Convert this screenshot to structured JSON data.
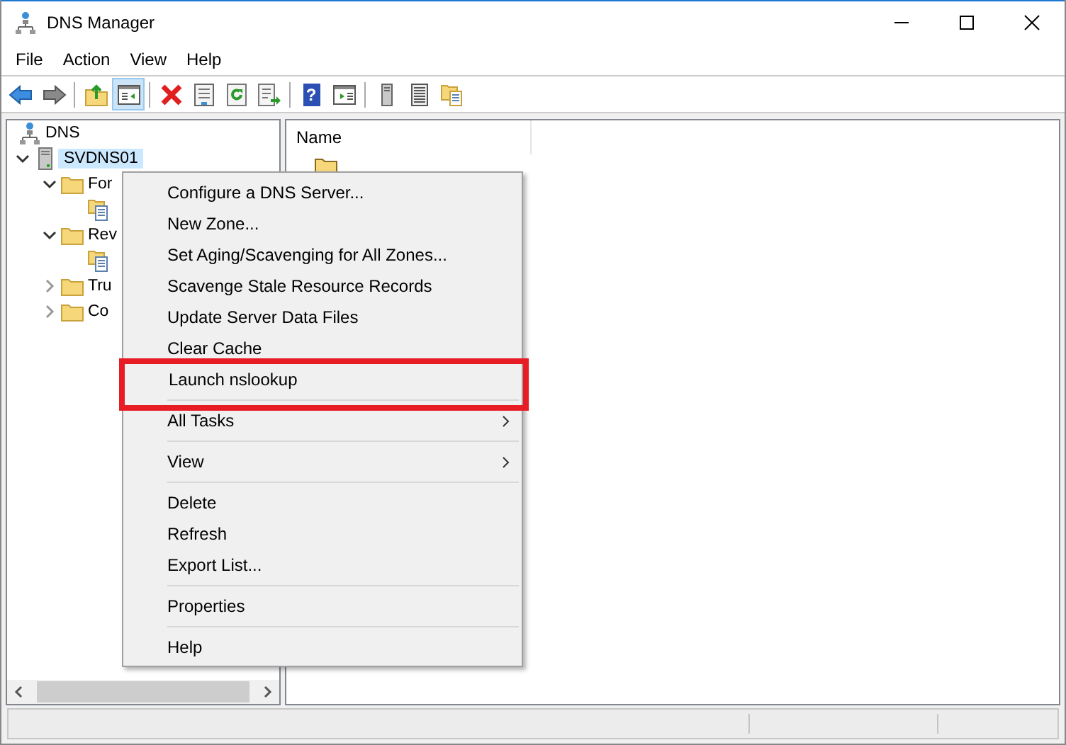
{
  "window": {
    "title": "DNS Manager"
  },
  "menu_bar": [
    "File",
    "Action",
    "View",
    "Help"
  ],
  "toolbar": [
    {
      "kind": "back",
      "pressed": false
    },
    {
      "kind": "forward",
      "pressed": false
    },
    {
      "kind": "separator"
    },
    {
      "kind": "up",
      "pressed": false
    },
    {
      "kind": "tree",
      "pressed": true
    },
    {
      "kind": "separator"
    },
    {
      "kind": "delete",
      "pressed": false
    },
    {
      "kind": "properties",
      "pressed": false
    },
    {
      "kind": "refresh",
      "pressed": false
    },
    {
      "kind": "export",
      "pressed": false
    },
    {
      "kind": "separator"
    },
    {
      "kind": "help",
      "label": "?",
      "pressed": false
    },
    {
      "kind": "action",
      "pressed": false
    },
    {
      "kind": "separator"
    },
    {
      "kind": "server",
      "pressed": false
    },
    {
      "kind": "list",
      "pressed": false
    },
    {
      "kind": "zones",
      "pressed": false
    }
  ],
  "tree": {
    "items": [
      {
        "label": "DNS",
        "kind": "dns",
        "selected": false,
        "children": [
          {
            "label": "SVDNS01",
            "kind": "server",
            "selected": true,
            "expanded": true,
            "children": [
              {
                "label": "For",
                "kind": "folder",
                "selected": false,
                "expanded": true,
                "children": [
                  {
                    "kind": "zone",
                    "selected": false
                  }
                ]
              },
              {
                "label": "Rev",
                "kind": "folder",
                "selected": false,
                "expanded": true,
                "children": [
                  {
                    "kind": "zone",
                    "selected": false
                  }
                ]
              },
              {
                "label": "Tru",
                "kind": "folder",
                "selected": false,
                "expanded": false
              },
              {
                "label": "Co",
                "kind": "folder",
                "selected": false,
                "expanded": false
              }
            ]
          }
        ]
      }
    ]
  },
  "list": {
    "columns": [
      "Name"
    ],
    "rows": [
      {
        "kind": "zone-folder"
      }
    ]
  },
  "context_menu": {
    "items": [
      {
        "kind": "item",
        "label": "Configure a DNS Server...",
        "highlighted": false
      },
      {
        "kind": "item",
        "label": "New Zone...",
        "highlighted": false
      },
      {
        "kind": "item",
        "label": "Set Aging/Scavenging for All Zones...",
        "highlighted": false
      },
      {
        "kind": "item",
        "label": "Scavenge Stale Resource Records",
        "highlighted": false
      },
      {
        "kind": "item",
        "label": "Update Server Data Files",
        "highlighted": false
      },
      {
        "kind": "item",
        "label": "Clear Cache",
        "highlighted": false
      },
      {
        "kind": "item",
        "label": "Launch nslookup",
        "highlighted": true
      },
      {
        "kind": "separator"
      },
      {
        "kind": "submenu",
        "label": "All Tasks",
        "highlighted": false
      },
      {
        "kind": "separator"
      },
      {
        "kind": "submenu",
        "label": "View",
        "highlighted": false
      },
      {
        "kind": "separator"
      },
      {
        "kind": "item",
        "label": "Delete",
        "highlighted": false
      },
      {
        "kind": "item",
        "label": "Refresh",
        "highlighted": false
      },
      {
        "kind": "item",
        "label": "Export List...",
        "highlighted": false
      },
      {
        "kind": "separator"
      },
      {
        "kind": "item",
        "label": "Properties",
        "highlighted": false
      },
      {
        "kind": "separator"
      },
      {
        "kind": "item",
        "label": "Help",
        "highlighted": false
      }
    ]
  }
}
